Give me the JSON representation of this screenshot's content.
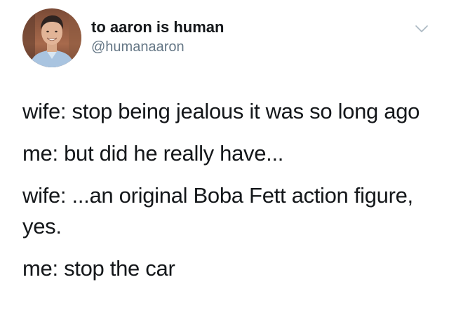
{
  "tweet": {
    "author": {
      "display_name": "to aaron is human",
      "handle": "@humanaaron",
      "avatar_icon": "profile-photo"
    },
    "menu_icon": "chevron-down-icon",
    "lines": [
      "wife: stop being jealous it was so long ago",
      "me: but did he really have...",
      "wife: ...an original Boba Fett action figure, yes.",
      "me: stop the car"
    ]
  },
  "colors": {
    "text": "#14171a",
    "secondary": "#657786",
    "background": "#ffffff"
  }
}
